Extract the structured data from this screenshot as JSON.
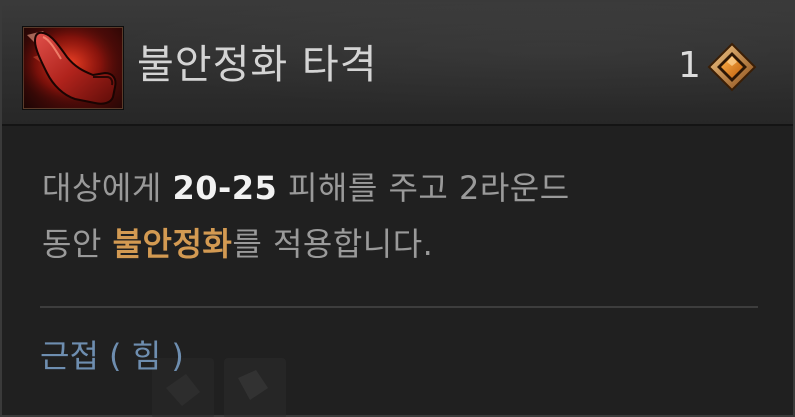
{
  "skill": {
    "name": "불안정화 타격",
    "icon": "red-kick-leg-icon",
    "cost": "1",
    "cost_icon": "orange-diamond-gem-icon"
  },
  "description": {
    "part1": "대상에게 ",
    "damage": "20-25",
    "part2": " 피해를 주고 2라운드",
    "part3": "동안 ",
    "effect": "불안정화",
    "part4": "를 적용합니다."
  },
  "tag": "근접 ( 힘 )",
  "colors": {
    "background": "#202020",
    "header": "#333333",
    "title_text": "#d4d4d4",
    "body_text": "#9a9a9a",
    "highlight_white": "#f2f2f2",
    "highlight_orange": "#d39a52",
    "tag_blue": "#6e8eb0",
    "gem_orange": "#e08a2a"
  }
}
